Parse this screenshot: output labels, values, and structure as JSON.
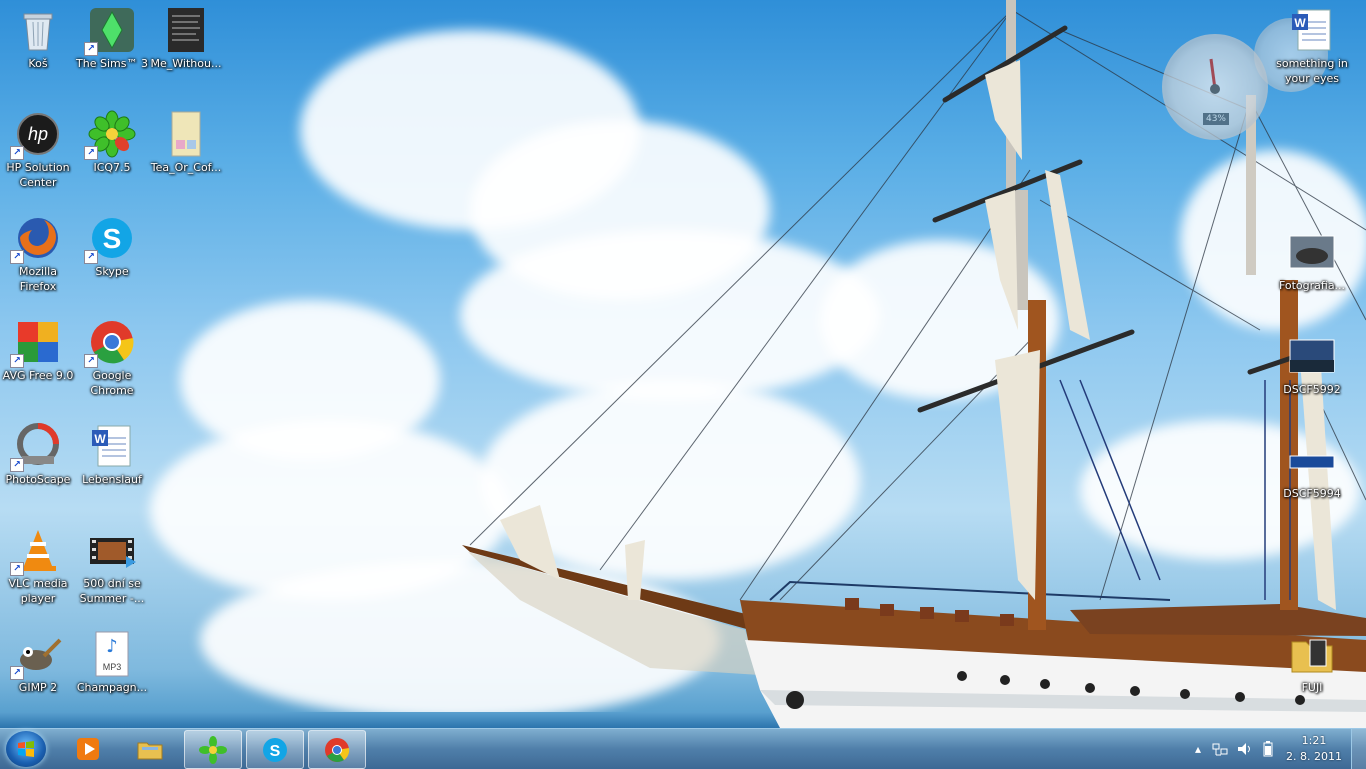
{
  "desktop": {
    "icons": [
      {
        "label": "Koš",
        "icon": "recycle-bin-icon"
      },
      {
        "label": "The Sims™ 3",
        "icon": "sims-icon"
      },
      {
        "label": "Me_Withou...",
        "icon": "document-thumbnail-icon"
      },
      {
        "label": "HP Solution Center",
        "icon": "hp-icon"
      },
      {
        "label": "ICQ7.5",
        "icon": "icq-flower-icon"
      },
      {
        "label": "Tea_Or_Cof...",
        "icon": "image-thumbnail-icon"
      },
      {
        "label": "Mozilla Firefox",
        "icon": "firefox-icon"
      },
      {
        "label": "Skype",
        "icon": "skype-icon"
      },
      {
        "label": "AVG Free 9.0",
        "icon": "avg-icon"
      },
      {
        "label": "Google Chrome",
        "icon": "chrome-icon"
      },
      {
        "label": "PhotoScape",
        "icon": "photoscape-icon"
      },
      {
        "label": "Lebenslauf",
        "icon": "word-document-icon"
      },
      {
        "label": "VLC media player",
        "icon": "vlc-icon"
      },
      {
        "label": "500 dní se Summer -...",
        "icon": "video-file-icon"
      },
      {
        "label": "GIMP 2",
        "icon": "gimp-icon"
      },
      {
        "label": "Champagn...",
        "icon": "mp3-file-icon"
      },
      {
        "label": "something in your eyes",
        "icon": "word-document-icon"
      },
      {
        "label": "Fotografia...",
        "icon": "photo-thumbnail-icon"
      },
      {
        "label": "DSCF5992",
        "icon": "photo-thumbnail-icon"
      },
      {
        "label": "DSCF5994",
        "icon": "photo-thumbnail-icon"
      },
      {
        "label": "FUJI",
        "icon": "folder-icon"
      }
    ]
  },
  "gadget": {
    "cpu_value": "43%"
  },
  "taskbar": {
    "pinned": [
      {
        "name": "windows-media-player",
        "icon": "media-player-icon",
        "active": false
      },
      {
        "name": "windows-explorer",
        "icon": "folder-library-icon",
        "active": false
      },
      {
        "name": "icq",
        "icon": "icq-flower-icon",
        "active": true
      },
      {
        "name": "skype",
        "icon": "skype-icon",
        "active": true
      },
      {
        "name": "google-chrome",
        "icon": "chrome-icon",
        "active": true
      }
    ],
    "tray": {
      "time": "1:21",
      "date": "2. 8. 2011",
      "icons": [
        "show-hidden-icons-arrow",
        "network-icon",
        "volume-icon",
        "battery-icon"
      ]
    }
  },
  "colors": {
    "sky_top": "#2f8fd8",
    "sky_bottom": "#b7dcf3",
    "taskbar": "#4a7ca8",
    "hull_wood": "#8a4a1e",
    "hull_white": "#f2f2f2"
  }
}
